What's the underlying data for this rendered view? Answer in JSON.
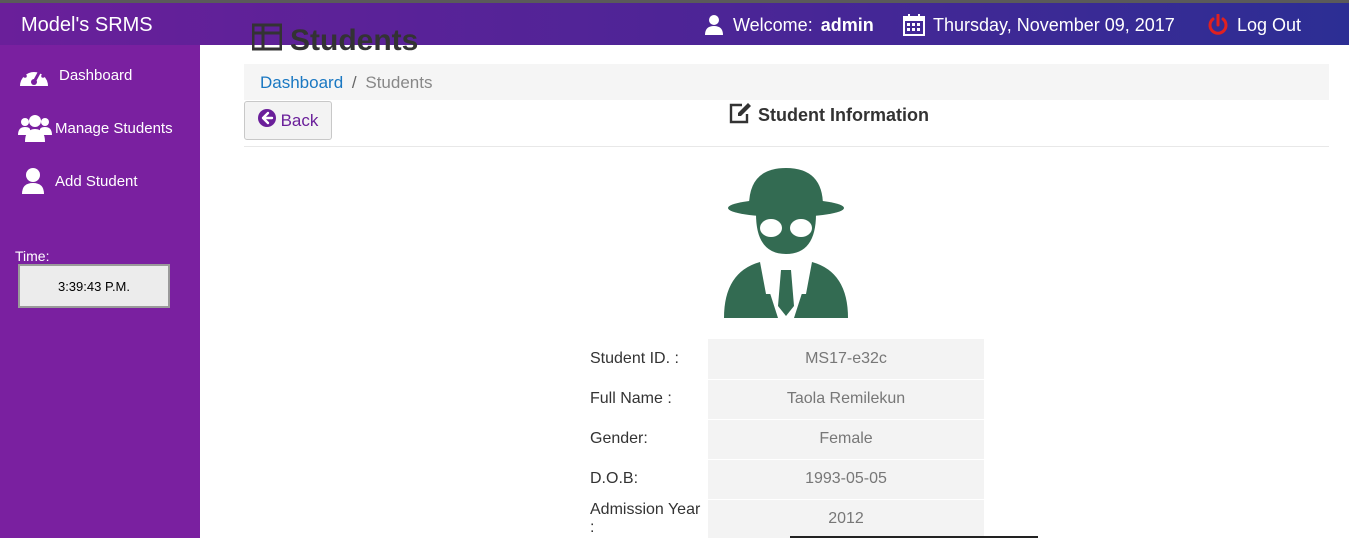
{
  "app": {
    "title": "Model's SRMS"
  },
  "topbar": {
    "welcome_prefix": "Welcome:",
    "username": "admin",
    "date": "Thursday, November 09, 2017",
    "logout_label": "Log Out"
  },
  "sidebar": {
    "items": [
      {
        "label": "Dashboard",
        "icon": "dashboard-icon"
      },
      {
        "label": "Manage Students",
        "icon": "users-icon"
      },
      {
        "label": "Add Student",
        "icon": "user-icon"
      }
    ],
    "time_label": "Time:",
    "time_value": "3:39:43 P.M."
  },
  "main": {
    "page_heading": "Students",
    "breadcrumb": {
      "home": "Dashboard",
      "separator": "/",
      "current": "Students"
    },
    "back_label": "Back",
    "section_title": "Student Information",
    "student": {
      "fields": [
        {
          "label": "Student ID. :",
          "value": "MS17-e32c"
        },
        {
          "label": "Full Name :",
          "value": "Taola Remilekun"
        },
        {
          "label": "Gender:",
          "value": "Female"
        },
        {
          "label": "D.O.B:",
          "value": "1993-05-05"
        },
        {
          "label": "Admission Year :",
          "value": "2012"
        }
      ]
    }
  },
  "colors": {
    "sidebar": "#7a20a0",
    "topbar_start": "#6a1f9a",
    "topbar_end": "#2c2e94",
    "logout_icon": "#e02020",
    "avatar": "#336b52",
    "link": "#1a78c2"
  }
}
